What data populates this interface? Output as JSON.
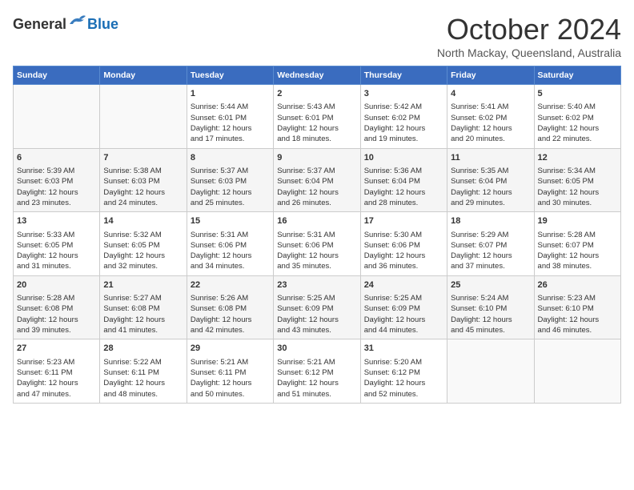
{
  "logo": {
    "general": "General",
    "blue": "Blue"
  },
  "title": "October 2024",
  "location": "North Mackay, Queensland, Australia",
  "days_of_week": [
    "Sunday",
    "Monday",
    "Tuesday",
    "Wednesday",
    "Thursday",
    "Friday",
    "Saturday"
  ],
  "weeks": [
    [
      {
        "day": "",
        "info": ""
      },
      {
        "day": "",
        "info": ""
      },
      {
        "day": "1",
        "info": "Sunrise: 5:44 AM\nSunset: 6:01 PM\nDaylight: 12 hours\nand 17 minutes."
      },
      {
        "day": "2",
        "info": "Sunrise: 5:43 AM\nSunset: 6:01 PM\nDaylight: 12 hours\nand 18 minutes."
      },
      {
        "day": "3",
        "info": "Sunrise: 5:42 AM\nSunset: 6:02 PM\nDaylight: 12 hours\nand 19 minutes."
      },
      {
        "day": "4",
        "info": "Sunrise: 5:41 AM\nSunset: 6:02 PM\nDaylight: 12 hours\nand 20 minutes."
      },
      {
        "day": "5",
        "info": "Sunrise: 5:40 AM\nSunset: 6:02 PM\nDaylight: 12 hours\nand 22 minutes."
      }
    ],
    [
      {
        "day": "6",
        "info": "Sunrise: 5:39 AM\nSunset: 6:03 PM\nDaylight: 12 hours\nand 23 minutes."
      },
      {
        "day": "7",
        "info": "Sunrise: 5:38 AM\nSunset: 6:03 PM\nDaylight: 12 hours\nand 24 minutes."
      },
      {
        "day": "8",
        "info": "Sunrise: 5:37 AM\nSunset: 6:03 PM\nDaylight: 12 hours\nand 25 minutes."
      },
      {
        "day": "9",
        "info": "Sunrise: 5:37 AM\nSunset: 6:04 PM\nDaylight: 12 hours\nand 26 minutes."
      },
      {
        "day": "10",
        "info": "Sunrise: 5:36 AM\nSunset: 6:04 PM\nDaylight: 12 hours\nand 28 minutes."
      },
      {
        "day": "11",
        "info": "Sunrise: 5:35 AM\nSunset: 6:04 PM\nDaylight: 12 hours\nand 29 minutes."
      },
      {
        "day": "12",
        "info": "Sunrise: 5:34 AM\nSunset: 6:05 PM\nDaylight: 12 hours\nand 30 minutes."
      }
    ],
    [
      {
        "day": "13",
        "info": "Sunrise: 5:33 AM\nSunset: 6:05 PM\nDaylight: 12 hours\nand 31 minutes."
      },
      {
        "day": "14",
        "info": "Sunrise: 5:32 AM\nSunset: 6:05 PM\nDaylight: 12 hours\nand 32 minutes."
      },
      {
        "day": "15",
        "info": "Sunrise: 5:31 AM\nSunset: 6:06 PM\nDaylight: 12 hours\nand 34 minutes."
      },
      {
        "day": "16",
        "info": "Sunrise: 5:31 AM\nSunset: 6:06 PM\nDaylight: 12 hours\nand 35 minutes."
      },
      {
        "day": "17",
        "info": "Sunrise: 5:30 AM\nSunset: 6:06 PM\nDaylight: 12 hours\nand 36 minutes."
      },
      {
        "day": "18",
        "info": "Sunrise: 5:29 AM\nSunset: 6:07 PM\nDaylight: 12 hours\nand 37 minutes."
      },
      {
        "day": "19",
        "info": "Sunrise: 5:28 AM\nSunset: 6:07 PM\nDaylight: 12 hours\nand 38 minutes."
      }
    ],
    [
      {
        "day": "20",
        "info": "Sunrise: 5:28 AM\nSunset: 6:08 PM\nDaylight: 12 hours\nand 39 minutes."
      },
      {
        "day": "21",
        "info": "Sunrise: 5:27 AM\nSunset: 6:08 PM\nDaylight: 12 hours\nand 41 minutes."
      },
      {
        "day": "22",
        "info": "Sunrise: 5:26 AM\nSunset: 6:08 PM\nDaylight: 12 hours\nand 42 minutes."
      },
      {
        "day": "23",
        "info": "Sunrise: 5:25 AM\nSunset: 6:09 PM\nDaylight: 12 hours\nand 43 minutes."
      },
      {
        "day": "24",
        "info": "Sunrise: 5:25 AM\nSunset: 6:09 PM\nDaylight: 12 hours\nand 44 minutes."
      },
      {
        "day": "25",
        "info": "Sunrise: 5:24 AM\nSunset: 6:10 PM\nDaylight: 12 hours\nand 45 minutes."
      },
      {
        "day": "26",
        "info": "Sunrise: 5:23 AM\nSunset: 6:10 PM\nDaylight: 12 hours\nand 46 minutes."
      }
    ],
    [
      {
        "day": "27",
        "info": "Sunrise: 5:23 AM\nSunset: 6:11 PM\nDaylight: 12 hours\nand 47 minutes."
      },
      {
        "day": "28",
        "info": "Sunrise: 5:22 AM\nSunset: 6:11 PM\nDaylight: 12 hours\nand 48 minutes."
      },
      {
        "day": "29",
        "info": "Sunrise: 5:21 AM\nSunset: 6:11 PM\nDaylight: 12 hours\nand 50 minutes."
      },
      {
        "day": "30",
        "info": "Sunrise: 5:21 AM\nSunset: 6:12 PM\nDaylight: 12 hours\nand 51 minutes."
      },
      {
        "day": "31",
        "info": "Sunrise: 5:20 AM\nSunset: 6:12 PM\nDaylight: 12 hours\nand 52 minutes."
      },
      {
        "day": "",
        "info": ""
      },
      {
        "day": "",
        "info": ""
      }
    ]
  ]
}
